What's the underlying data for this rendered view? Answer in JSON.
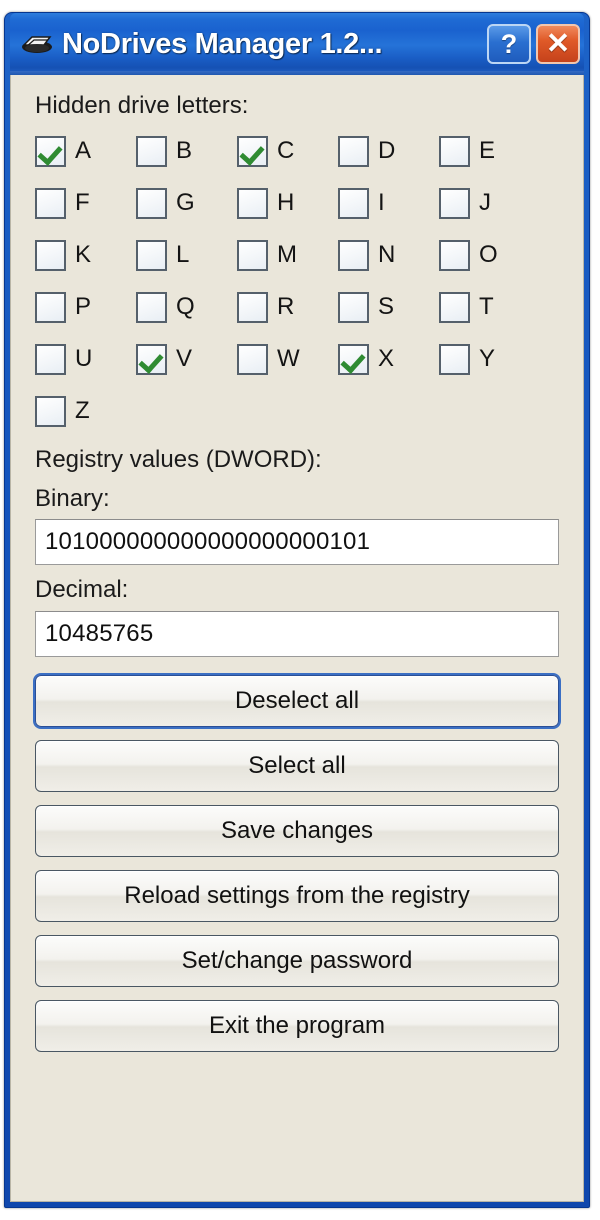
{
  "window": {
    "title": "NoDrives Manager 1.2...",
    "icon": "drive-icon",
    "help_label": "?",
    "close_label": "✕",
    "frame_color": "#1352bb",
    "client_color": "#eae6da"
  },
  "drives": {
    "heading": "Hidden drive letters:",
    "letters": [
      {
        "letter": "A",
        "checked": true
      },
      {
        "letter": "B",
        "checked": false
      },
      {
        "letter": "C",
        "checked": true
      },
      {
        "letter": "D",
        "checked": false
      },
      {
        "letter": "E",
        "checked": false
      },
      {
        "letter": "F",
        "checked": false
      },
      {
        "letter": "G",
        "checked": false
      },
      {
        "letter": "H",
        "checked": false
      },
      {
        "letter": "I",
        "checked": false
      },
      {
        "letter": "J",
        "checked": false
      },
      {
        "letter": "K",
        "checked": false
      },
      {
        "letter": "L",
        "checked": false
      },
      {
        "letter": "M",
        "checked": false
      },
      {
        "letter": "N",
        "checked": false
      },
      {
        "letter": "O",
        "checked": false
      },
      {
        "letter": "P",
        "checked": false
      },
      {
        "letter": "Q",
        "checked": false
      },
      {
        "letter": "R",
        "checked": false
      },
      {
        "letter": "S",
        "checked": false
      },
      {
        "letter": "T",
        "checked": false
      },
      {
        "letter": "U",
        "checked": false
      },
      {
        "letter": "V",
        "checked": true
      },
      {
        "letter": "W",
        "checked": false
      },
      {
        "letter": "X",
        "checked": true
      },
      {
        "letter": "Y",
        "checked": false
      },
      {
        "letter": "Z",
        "checked": false
      }
    ],
    "checkmark_color": "#2f8b32"
  },
  "registry": {
    "heading": "Registry values (DWORD):",
    "binary_label": "Binary:",
    "binary_value": "101000000000000000000101",
    "decimal_label": "Decimal:",
    "decimal_value": "10485765"
  },
  "buttons": [
    {
      "label": "Deselect all",
      "default": true
    },
    {
      "label": "Select all",
      "default": false
    },
    {
      "label": "Save changes",
      "default": false
    },
    {
      "label": "Reload settings from the registry",
      "default": false
    },
    {
      "label": "Set/change password",
      "default": false
    },
    {
      "label": "Exit the program",
      "default": false
    }
  ]
}
